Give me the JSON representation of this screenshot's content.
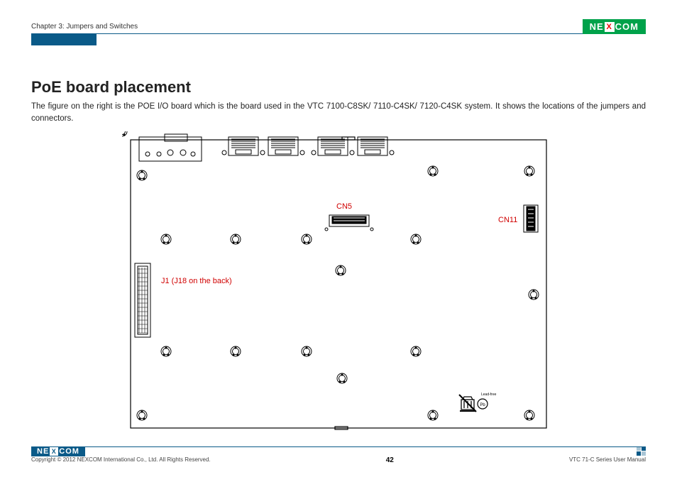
{
  "header": {
    "chapter": "Chapter 3: Jumpers and Switches",
    "logo_left": "NE",
    "logo_x": "X",
    "logo_right": "COM"
  },
  "main": {
    "title": "PoE board placement",
    "body": "The figure on the right is the POE I/O board which is the board used in the VTC 7100-C8SK/ 7110-C4SK/ 7120-C4SK system. It shows the locations of the jumpers and connectors."
  },
  "labels": {
    "cn5": "CN5",
    "cn11": "CN11",
    "j1": "J1 (J18 on the back)"
  },
  "footer": {
    "logo_left": "NE",
    "logo_x": "X",
    "logo_right": "COM",
    "copyright": "Copyright © 2012 NEXCOM International Co., Ltd. All Rights Reserved.",
    "page": "42",
    "manual": "VTC 71-C Series User Manual"
  }
}
